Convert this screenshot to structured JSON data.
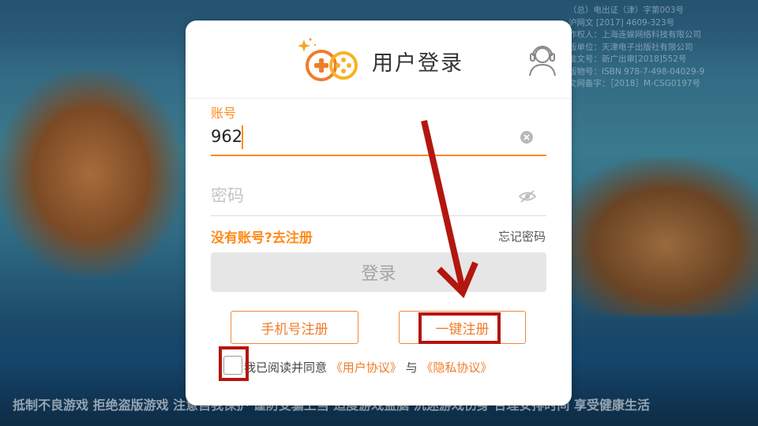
{
  "background": {
    "license_lines": [
      "（总）电出证（津）字第003号",
      "沪网文 [2017] 4609-323号",
      "作权人：上海连娱网络科技有限公司",
      "版单位：天津电子出版社有限公司",
      "准文号：新广出审[2018]552号",
      "版物号：ISBN 978-7-498-04029-9",
      "文网备字：［2018］M-CSG0197号"
    ],
    "slogan": "抵制不良游戏 拒绝盗版游戏 注意自我保护 谨防受骗上当 适度游戏益脑 沉迷游戏伤身 合理安排时间 享受健康生活"
  },
  "dialog": {
    "title": "用户登录",
    "account": {
      "label": "账号",
      "value": "962"
    },
    "password": {
      "placeholder": "密码"
    },
    "register_link": "没有账号?去注册",
    "forgot_link": "忘记密码",
    "login_button": "登录",
    "phone_register_button": "手机号注册",
    "onekey_register_button": "一键注册",
    "agreement": {
      "prefix": "我已阅读并同意",
      "user_agreement": "《用户协议》",
      "connector": "与",
      "privacy_policy": "《隐私协议》",
      "checked": false
    }
  },
  "colors": {
    "accent": "#ff8a1a",
    "annotation_red": "#b3160e"
  }
}
